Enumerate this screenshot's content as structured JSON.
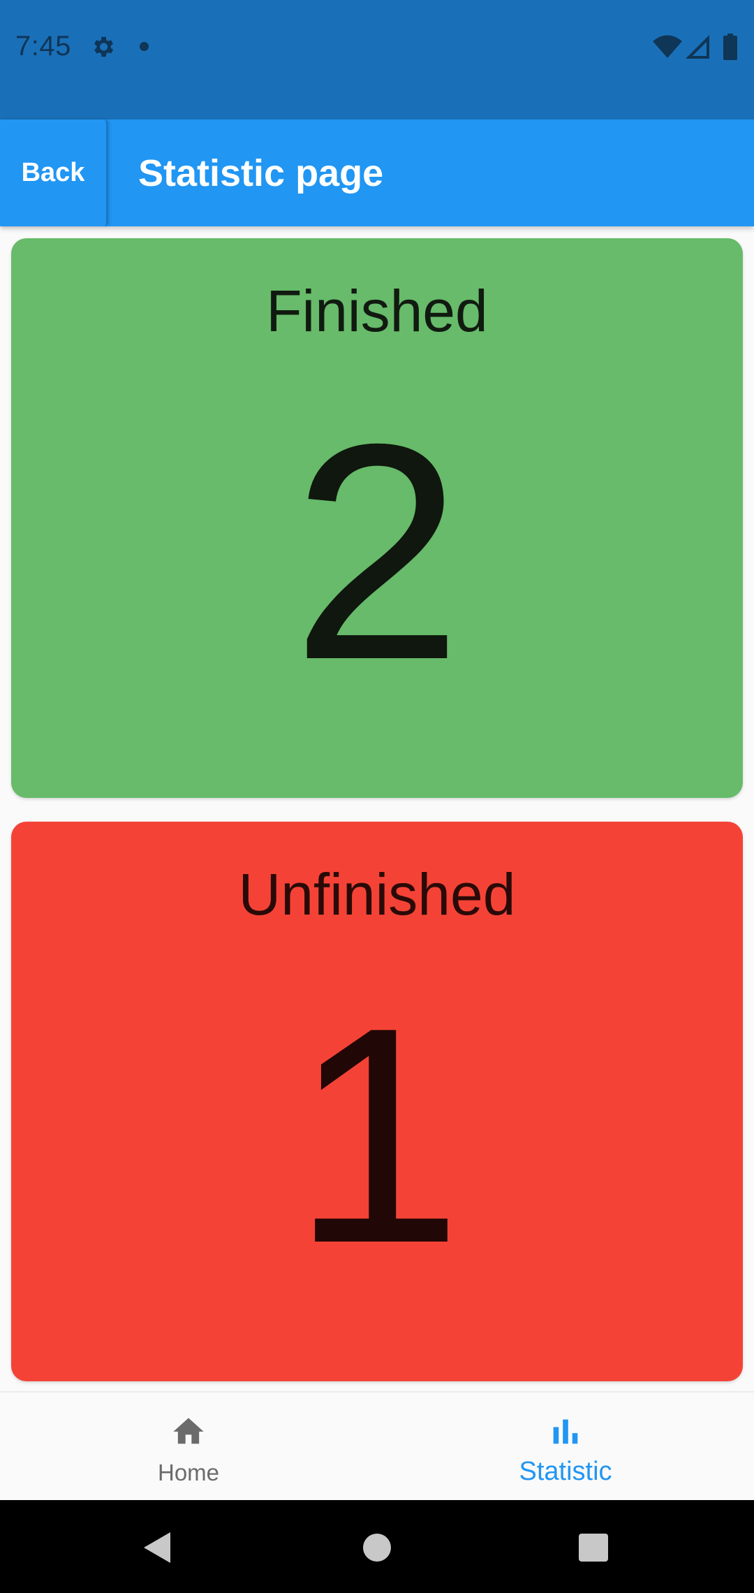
{
  "status_bar": {
    "time": "7:45",
    "icons": [
      "gear-icon",
      "notification-dot-icon",
      "wifi-icon",
      "signal-icon",
      "battery-icon"
    ]
  },
  "app_bar": {
    "back_label": "Back",
    "title": "Statistic page"
  },
  "cards": {
    "finished": {
      "label": "Finished",
      "count": "2",
      "color": "#67bb6a"
    },
    "unfinished": {
      "label": "Unfinished",
      "count": "1",
      "color": "#f44336"
    }
  },
  "bottom_nav": {
    "items": [
      {
        "label": "Home",
        "icon": "home-icon",
        "active": false
      },
      {
        "label": "Statistic",
        "icon": "bar-chart-icon",
        "active": true
      }
    ],
    "active_color": "#2196f3",
    "inactive_color": "#6b6b6b"
  },
  "colors": {
    "status_bar": "#1a70b8",
    "app_bar": "#2196f3"
  }
}
